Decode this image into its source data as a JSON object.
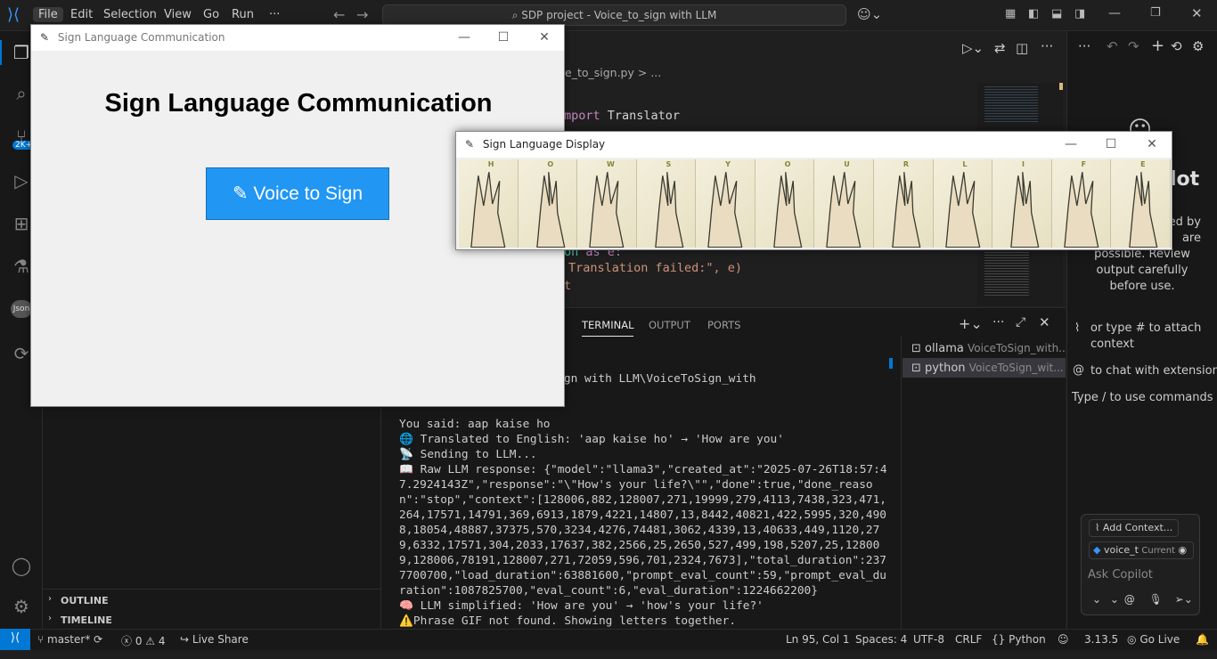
{
  "titlebar": {
    "menus": [
      "File",
      "Edit",
      "Selection",
      "View",
      "Go",
      "Run",
      "···"
    ],
    "command_center": "SDP project - Voice_to_sign with LLM"
  },
  "activity": {
    "badge": "2K+",
    "json_label": "Json"
  },
  "sidebar": {
    "outline": "OUTLINE",
    "timeline": "TIMELINE"
  },
  "editor": {
    "breadcrumb": "e_to_sign.py > ...",
    "code": [
      {
        "a": "mport ",
        "b": "Translator"
      },
      {
        "a": "on ",
        "b": "as e:"
      },
      {
        "a": "Translation failed:\", e)",
        "b": ""
      },
      {
        "a": "t",
        "b": ""
      }
    ]
  },
  "panel": {
    "tabs": [
      "TERMINAL",
      "OUTPUT",
      "PORTS"
    ],
    "terminal_lines": [
      "DP project - Voice_to_sign with LLM\\VoiceToSign_with",
      "",
      "",
      "You said: aap kaise ho",
      "🌐 Translated to English: 'aap kaise ho' → 'How are you'",
      "📡 Sending to LLM...",
      "📖 Raw LLM response: {\"model\":\"llama3\",\"created_at\":\"2025-07-26T18:57:47.2924143Z\",\"response\":\"\\\"How's your life?\\\"\",\"done\":true,\"done_reason\":\"stop\",\"context\":[128006,882,128007,271,19999,279,4113,7438,323,471,264,17571,14791,369,6913,1879,4221,14807,13,8442,40821,422,5995,320,4908,18054,48887,37375,570,3234,4276,74481,3062,4339,13,40633,449,1120,279,6332,17571,304,2033,17637,382,2566,25,2650,527,499,198,5207,25,128009,128006,78191,128007,271,72059,596,701,2324,7673],\"total_duration\":2377700700,\"load_duration\":63881600,\"prompt_eval_count\":59,\"prompt_eval_duration\":1087825700,\"eval_count\":6,\"eval_duration\":1224662200}",
      "🧠 LLM simplified: 'How are you' → 'how's your life?'",
      "⚠️Phrase GIF not found. Showing letters together.",
      "▯"
    ],
    "terminals": [
      {
        "name": "ollama",
        "sub": "VoiceToSign_with..."
      },
      {
        "name": "python",
        "sub": "VoiceToSign_wit..."
      }
    ]
  },
  "chat": {
    "title_partial": "lot",
    "disclaimer": [
      "ed by",
      "are",
      "possible. Review",
      "output carefully",
      "before use."
    ],
    "hint_attach": "or type # to attach context",
    "hint_ext": "to chat with extensions",
    "hint_cmd": "Type / to use commands",
    "add_context": "Add Context...",
    "file_chip": "voice_t",
    "file_chip_tag": "Current",
    "input_placeholder": "Ask Copilot"
  },
  "status": {
    "branch": "master*",
    "errors": "0",
    "warnings": "4",
    "live_share": "Live Share",
    "position": "Ln 95, Col 1",
    "spaces": "Spaces: 4",
    "encoding": "UTF-8",
    "eol": "CRLF",
    "language": "Python",
    "version": "3.13.5",
    "go_live": "Go Live"
  },
  "win1": {
    "title": "Sign Language Communication",
    "heading": "Sign Language Communication",
    "button": "Voice to Sign"
  },
  "win2": {
    "title": "Sign Language Display",
    "letters": [
      "H",
      "O",
      "W",
      "S",
      "Y",
      "O",
      "U",
      "R",
      "L",
      "I",
      "F",
      "E"
    ]
  }
}
